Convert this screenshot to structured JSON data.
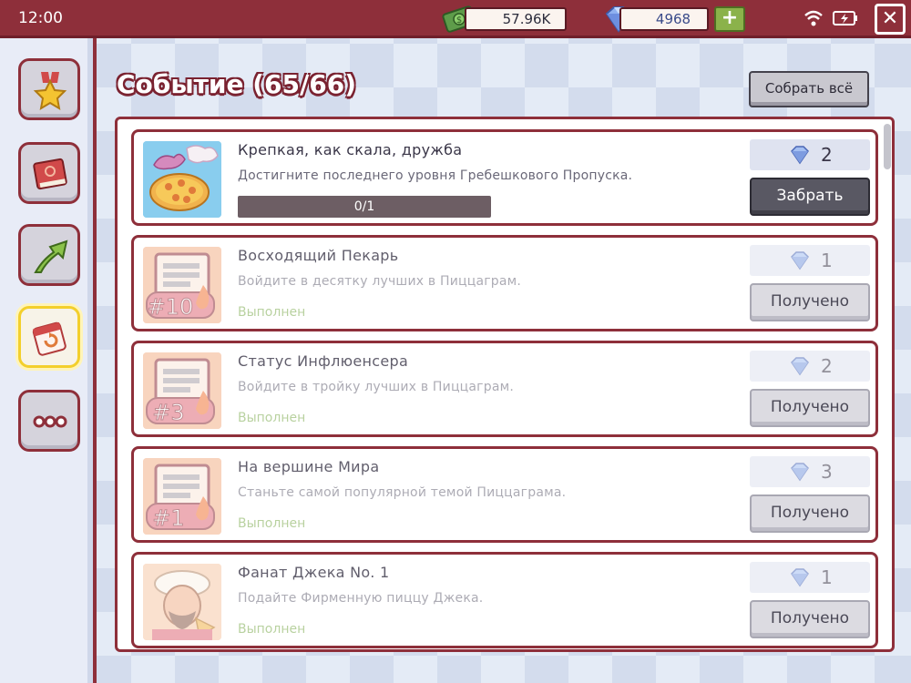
{
  "status_bar": {
    "time": "12:00",
    "cash": "57.96K",
    "gems": "4968",
    "plus_label": "+",
    "close_label": "✕"
  },
  "sidebar": {
    "items": [
      {
        "name": "medal-icon"
      },
      {
        "name": "book-icon"
      },
      {
        "name": "arrow-up-icon"
      },
      {
        "name": "calendar-icon",
        "active": true
      },
      {
        "name": "more-icon"
      }
    ]
  },
  "header": {
    "title": "Событие (65/66)",
    "collect_all": "Собрать всё"
  },
  "quests": [
    {
      "title": "Крепкая, как скала, дружба",
      "desc": "Достигните последнего уровня Гребешкового Пропуска.",
      "progress_text": "0/1",
      "progress": 0,
      "reward": "2",
      "button": "Забрать"
    },
    {
      "title": "Восходящий Пекарь",
      "desc": "Войдите в десятку лучших в Пиццаграм.",
      "status": "Выполнен",
      "reward": "1",
      "button": "Получено",
      "badge": "#10"
    },
    {
      "title": "Статус Инфлюенсера",
      "desc": "Войдите в тройку лучших в Пиццаграм.",
      "status": "Выполнен",
      "reward": "2",
      "button": "Получено",
      "badge": "#3"
    },
    {
      "title": "На вершине Мира",
      "desc": "Станьте самой популярной темой Пиццаграма.",
      "status": "Выполнен",
      "reward": "3",
      "button": "Получено",
      "badge": "#1"
    },
    {
      "title": "Фанат Джека No. 1",
      "desc": "Подайте Фирменную пиццу Джека.",
      "status": "Выполнен",
      "reward": "1",
      "button": "Получено"
    }
  ],
  "colors": {
    "accent": "#8e2f3a",
    "completed_text": "#7fad52",
    "gem": "#7e9ce0"
  }
}
